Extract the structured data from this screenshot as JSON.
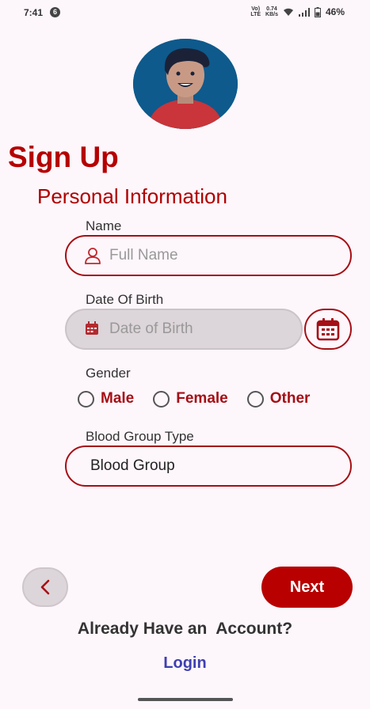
{
  "status_bar": {
    "time": "7:41",
    "notification_badge": "6",
    "network_label_top": "Vo)",
    "network_label_bottom": "LTE",
    "speed_top": "0.74",
    "speed_bottom": "KB/s",
    "battery": "46%"
  },
  "form": {
    "title": "Sign Up",
    "subtitle": "Personal Information",
    "name_label": "Name",
    "name_placeholder": "Full Name",
    "dob_label": "Date Of Birth",
    "dob_placeholder": "Date of Birth",
    "gender_label": "Gender",
    "gender_options": [
      "Male",
      "Female",
      "Other"
    ],
    "blood_label": "Blood Group Type",
    "blood_value": "Blood Group"
  },
  "footer": {
    "next_label": "Next",
    "account_text": "Already Have an  Account?",
    "login_label": "Login"
  },
  "colors": {
    "accent": "#b80000",
    "link": "#3f3fb0",
    "background": "#fdf6fb"
  },
  "icons": {
    "name_field": "person-icon",
    "dob_field": "calendar-icon",
    "back": "chevron-left-icon"
  }
}
